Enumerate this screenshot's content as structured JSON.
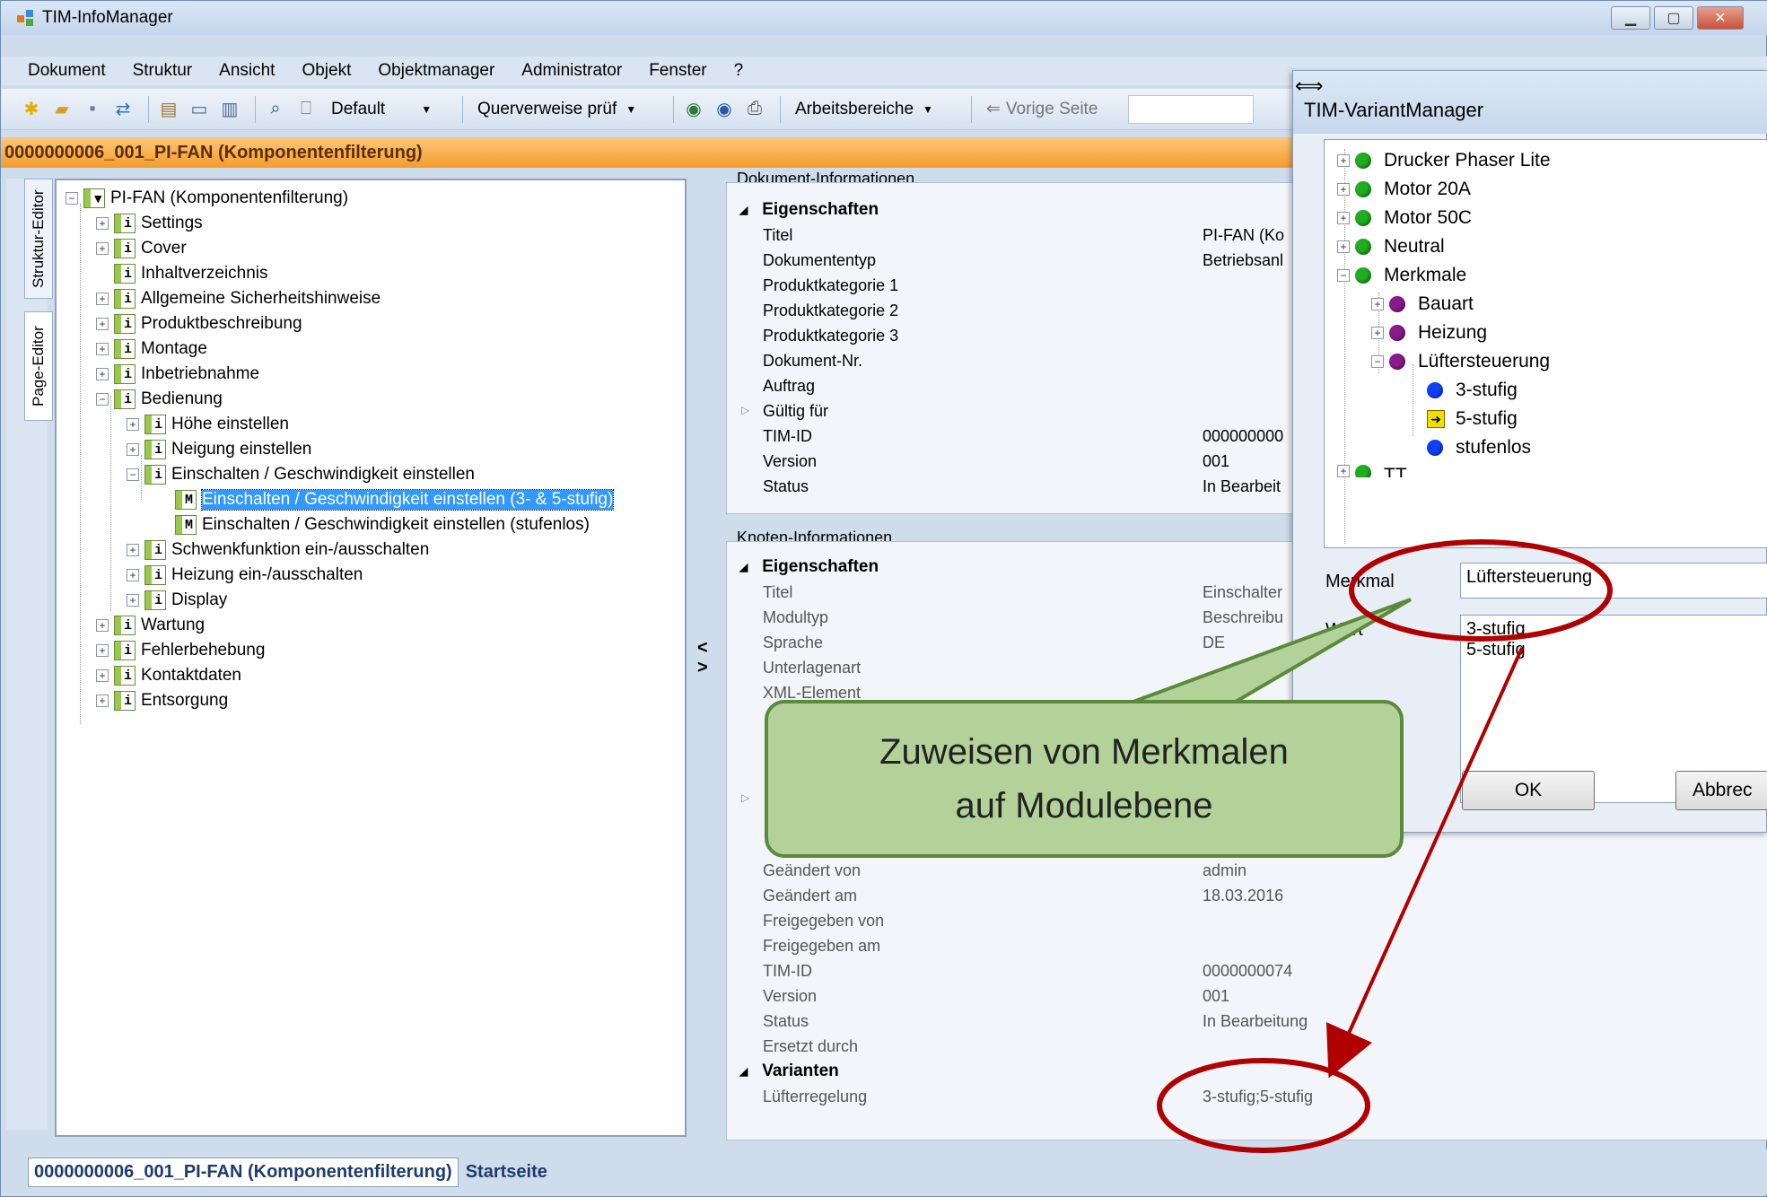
{
  "window": {
    "title": "TIM-InfoManager"
  },
  "menu": [
    "Dokument",
    "Struktur",
    "Ansicht",
    "Objekt",
    "Objektmanager",
    "Administrator",
    "Fenster",
    "?"
  ],
  "toolbar": {
    "combo_default": "Default",
    "combo_querverweise": "Querverweise prüf",
    "arbeitsbereiche": "Arbeitsbereiche",
    "vorige_seite": "Vorige Seite"
  },
  "document_title": "0000000006_001_PI-FAN (Komponentenfilterung)",
  "side_tabs": {
    "struktur": "Struktur-Editor",
    "page": "Page-Editor"
  },
  "tree": {
    "root": "PI-FAN (Komponentenfilterung)",
    "n1": "Settings",
    "n2": "Cover",
    "n3": "Inhaltverzeichnis",
    "n4": "Allgemeine Sicherheitshinweise",
    "n5": "Produktbeschreibung",
    "n6": "Montage",
    "n7": "Inbetriebnahme",
    "n8": "Bedienung",
    "n8a": "Höhe einstellen",
    "n8b": "Neigung einstellen",
    "n8c": "Einschalten / Geschwindigkeit einstellen",
    "n8c1": "Einschalten / Geschwindigkeit einstellen (3- & 5-stufig)",
    "n8c2": "Einschalten / Geschwindigkeit einstellen (stufenlos)",
    "n8d": "Schwenkfunktion ein-/ausschalten",
    "n8e": "Heizung ein-/ausschalten",
    "n8f": "Display",
    "n9": "Wartung",
    "n10": "Fehlerbehebung",
    "n11": "Kontaktdaten",
    "n12": "Entsorgung",
    "icon_i": "i",
    "icon_m": "M"
  },
  "splitter": {
    "left": "<",
    "right": ">"
  },
  "doc_info": {
    "title": "Dokument-Informationen",
    "group": "Eigenschaften",
    "rows": [
      {
        "k": "Titel",
        "v": "PI-FAN (Ko"
      },
      {
        "k": "Dokumententyp",
        "v": "Betriebsanl"
      },
      {
        "k": "Produktkategorie 1",
        "v": ""
      },
      {
        "k": "Produktkategorie 2",
        "v": ""
      },
      {
        "k": "Produktkategorie 3",
        "v": ""
      },
      {
        "k": "Dokument-Nr.",
        "v": ""
      },
      {
        "k": "Auftrag",
        "v": ""
      },
      {
        "k": "Gültig für",
        "v": ""
      },
      {
        "k": "TIM-ID",
        "v": "000000000"
      },
      {
        "k": "Version",
        "v": "001"
      },
      {
        "k": "Status",
        "v": "In Bearbeit"
      }
    ]
  },
  "node_info": {
    "title": "Knoten-Informationen",
    "group": "Eigenschaften",
    "rows_top": [
      {
        "k": "Titel",
        "v": "Einschalter"
      },
      {
        "k": "Modultyp",
        "v": "Beschreibu"
      },
      {
        "k": "Sprache",
        "v": "DE"
      },
      {
        "k": "Unterlagenart",
        "v": ""
      },
      {
        "k": "XML-Element",
        "v": ""
      }
    ],
    "rows_bottom": [
      {
        "k": "Geändert von",
        "v": "admin"
      },
      {
        "k": "Geändert am",
        "v": "18.03.2016"
      },
      {
        "k": "Freigegeben von",
        "v": ""
      },
      {
        "k": "Freigegeben am",
        "v": ""
      },
      {
        "k": "TIM-ID",
        "v": "0000000074"
      },
      {
        "k": "Version",
        "v": "001"
      },
      {
        "k": "Status",
        "v": "In Bearbeitung"
      },
      {
        "k": "Ersetzt durch",
        "v": ""
      }
    ],
    "variants_group": "Varianten",
    "variant_row": {
      "k": "Lüfterregelung",
      "v": "3-stufig;5-stufig"
    }
  },
  "variant_manager": {
    "title": "TIM-VariantManager",
    "tree": [
      "Drucker Phaser Lite",
      "Motor 20A",
      "Motor 50C",
      "Neutral",
      "Merkmale",
      "Bauart",
      "Heizung",
      "Lüftersteuerung",
      "3-stufig",
      "5-stufig",
      "stufenlos",
      "TT"
    ],
    "merkmal_label": "Merkmal",
    "merkmal_value": "Lüftersteuerung",
    "wert_label": "Wert",
    "wert_values": [
      "3-stufig",
      "5-stufig"
    ],
    "ok": "OK",
    "cancel": "Abbrec"
  },
  "callout": {
    "line1": "Zuweisen von Merkmalen",
    "line2": "auf Modulebene"
  },
  "bottom_tabs": {
    "doc": "0000000006_001_PI-FAN (Komponentenfilterung)",
    "start": "Startseite"
  },
  "colors": {
    "accent_orange": "#f49c2b",
    "selection": "#3399ff",
    "callout_fill": "#b3d29a",
    "annotation_red": "#b00000",
    "green_dot": "#1fae1f",
    "purple_dot": "#8b1a8b",
    "blue_dot": "#1040ff"
  }
}
